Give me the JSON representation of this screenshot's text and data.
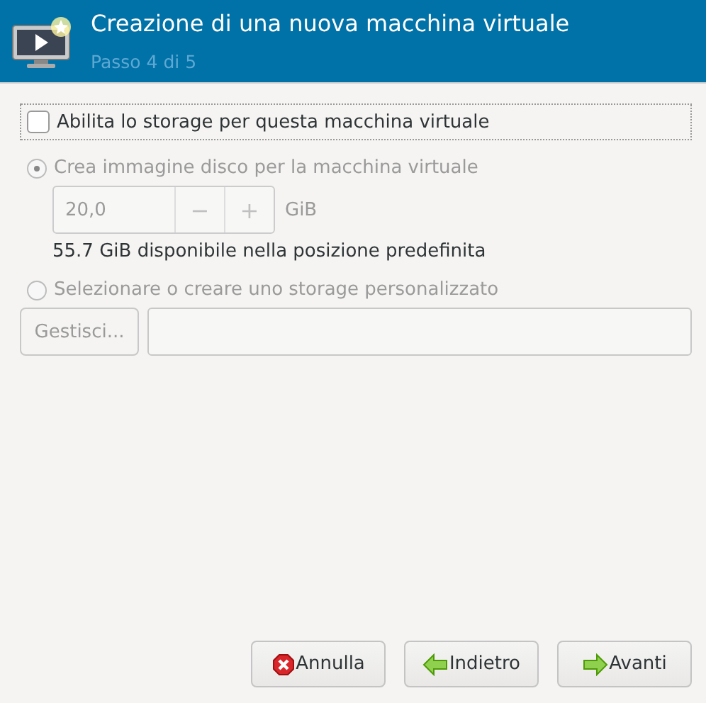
{
  "header": {
    "title": "Creazione di una nuova macchina virtuale",
    "subtitle": "Passo 4 di 5"
  },
  "enable_storage": {
    "label": "Abilita lo storage per questa macchina virtuale",
    "checked": false
  },
  "storage_options": [
    {
      "kind": "create",
      "label": "Crea immagine disco per la macchina virtuale",
      "selected": true,
      "disabled": true
    },
    {
      "kind": "custom",
      "label": "Selezionare o creare uno storage personalizzato",
      "selected": false,
      "disabled": true
    }
  ],
  "disk_size": {
    "value": "20,0",
    "decrement": "−",
    "increment": "+",
    "unit": "GiB",
    "disabled": true
  },
  "available_note": "55.7 GiB disponibile nella posizione predefinita",
  "manage_button": {
    "label": "Gestisci...",
    "disabled": true
  },
  "buttons": [
    {
      "kind": "cancel",
      "label": "Annulla"
    },
    {
      "kind": "back",
      "label": "Indietro"
    },
    {
      "kind": "forward",
      "label": "Avanti"
    }
  ]
}
